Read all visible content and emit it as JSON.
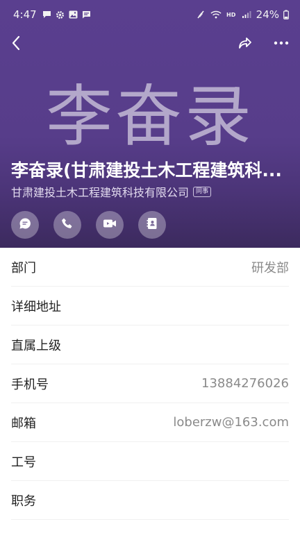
{
  "status_bar": {
    "time": "4:47",
    "battery": "24%",
    "icons": [
      "chat-bubble-icon",
      "gear-icon",
      "gallery-icon",
      "message-icon",
      "mute-icon",
      "wifi-icon",
      "hd-icon",
      "signal-icon",
      "battery-icon"
    ]
  },
  "header": {
    "avatar_text": "李奋录",
    "name": "李奋录(甘肃建投土木工程建筑科...",
    "organization": "甘肃建投土木工程建筑科技有限公司",
    "badge": "同事",
    "background": "#5a3f8f",
    "actions": [
      "message-icon",
      "phone-icon",
      "video-icon",
      "contacts-icon"
    ]
  },
  "fields": [
    {
      "label": "部门",
      "value": "研发部"
    },
    {
      "label": "详细地址",
      "value": ""
    },
    {
      "label": "直属上级",
      "value": ""
    },
    {
      "label": "手机号",
      "value": "13884276026"
    },
    {
      "label": "邮箱",
      "value": "loberzw@163.com"
    },
    {
      "label": "工号",
      "value": ""
    },
    {
      "label": "职务",
      "value": ""
    }
  ]
}
